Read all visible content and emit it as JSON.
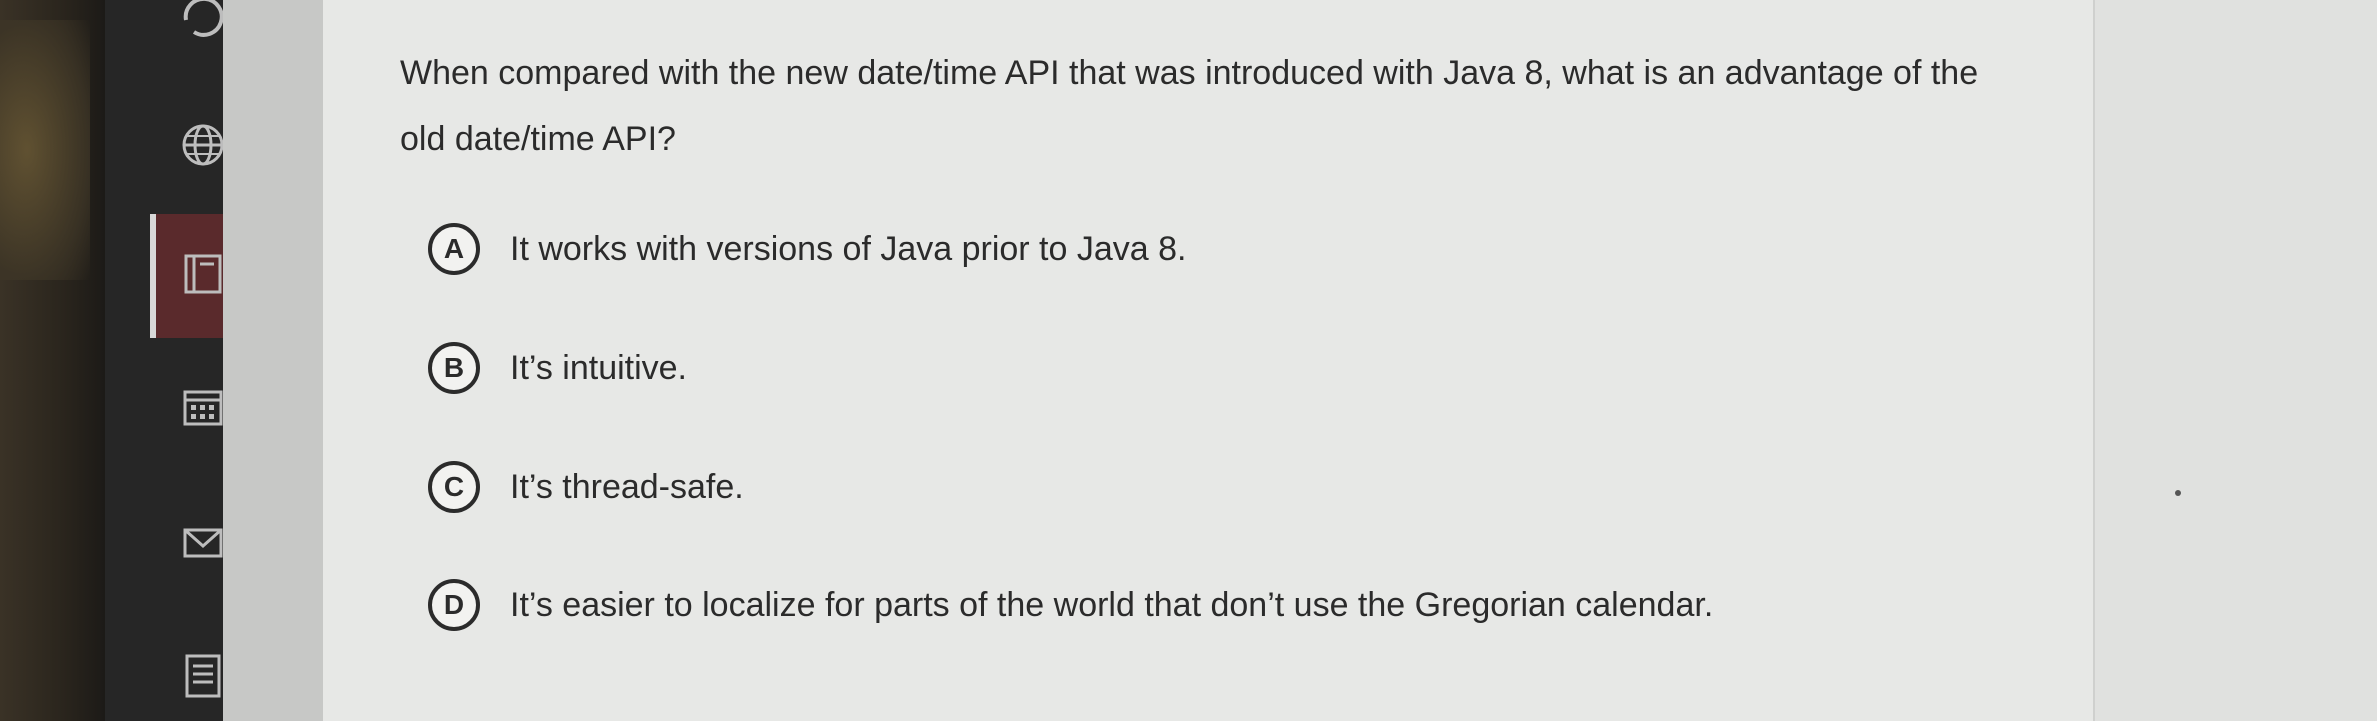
{
  "sidebar": {
    "icons": [
      "history-icon",
      "globe-icon",
      "book-icon",
      "calendar-icon",
      "mail-icon",
      "document-icon"
    ],
    "active_color": "#5a2a2c"
  },
  "question": {
    "text": "When compared with the new date/time API that was introduced with Java 8, what is an advantage of the old date/time API?",
    "options": [
      {
        "letter": "A",
        "text": "It works with versions of Java prior to Java 8."
      },
      {
        "letter": "B",
        "text": "It’s intuitive."
      },
      {
        "letter": "C",
        "text": "It’s thread-safe."
      },
      {
        "letter": "D",
        "text": "It’s easier to localize for parts of the world that don’t use the Gregorian calendar."
      }
    ]
  }
}
